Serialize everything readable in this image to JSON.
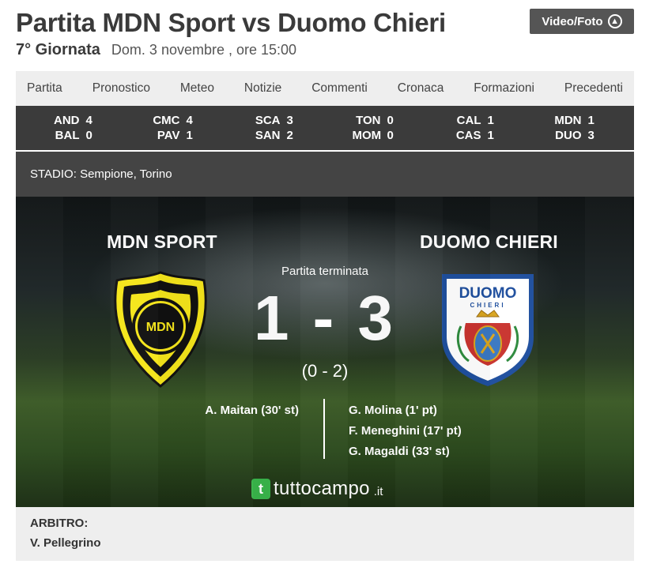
{
  "header": {
    "title": "Partita MDN Sport vs Duomo Chieri",
    "media_button": "Video/Foto",
    "round": "7° Giornata",
    "date": "Dom. 3 novembre , ore 15:00"
  },
  "tabs": [
    "Partita",
    "Pronostico",
    "Meteo",
    "Notizie",
    "Commenti",
    "Cronaca",
    "Formazioni",
    "Precedenti"
  ],
  "ticker": [
    {
      "home": "AND",
      "home_score": "4",
      "away": "BAL",
      "away_score": "0"
    },
    {
      "home": "CMC",
      "home_score": "4",
      "away": "PAV",
      "away_score": "1"
    },
    {
      "home": "SCA",
      "home_score": "3",
      "away": "SAN",
      "away_score": "2"
    },
    {
      "home": "TON",
      "home_score": "0",
      "away": "MOM",
      "away_score": "0"
    },
    {
      "home": "CAL",
      "home_score": "1",
      "away": "CAS",
      "away_score": "1"
    },
    {
      "home": "MDN",
      "home_score": "1",
      "away": "DUO",
      "away_score": "3"
    }
  ],
  "stadium": {
    "label": "STADIO:",
    "value": "Sempione, Torino"
  },
  "match": {
    "home_team": "MDN SPORT",
    "away_team": "DUOMO CHIERI",
    "status": "Partita terminata",
    "score": "1 - 3",
    "half_time": "(0 - 2)",
    "home_crest_text": "MDN",
    "away_crest_text": "DUOMO",
    "away_crest_sub": "CHIERI",
    "home_scorers": [
      "A. Maitan (30' st)"
    ],
    "away_scorers": [
      "G. Molina (1' pt)",
      "F. Meneghini (17' pt)",
      "G. Magaldi (33' st)"
    ]
  },
  "brand": {
    "mark": "t",
    "name": "tuttocampo",
    "tld": ".it"
  },
  "referee": {
    "label": "ARBITRO:",
    "name": "V. Pellegrino"
  },
  "colors": {
    "home_primary": "#f5e51b",
    "home_secondary": "#111111",
    "away_primary": "#1f4f9e",
    "brand_green": "#39b54a",
    "ticker_bg": "#3b3b3b"
  }
}
